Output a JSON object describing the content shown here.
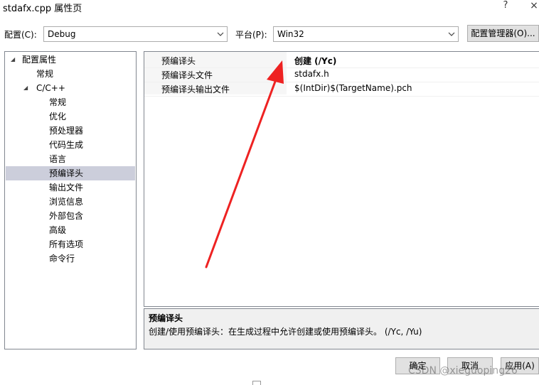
{
  "window": {
    "title": "stdafx.cpp 属性页",
    "help": "?",
    "close": "×"
  },
  "toolbar": {
    "config_label": "配置(C):",
    "config_value": "Debug",
    "platform_label": "平台(P):",
    "platform_value": "Win32",
    "config_manager_label": "配置管理器(O)..."
  },
  "tree": {
    "root": "配置属性",
    "general": "常规",
    "cpp": "C/C++",
    "cpp_children": [
      "常规",
      "优化",
      "预处理器",
      "代码生成",
      "语言",
      "预编译头",
      "输出文件",
      "浏览信息",
      "外部包含",
      "高级",
      "所有选项",
      "命令行"
    ],
    "selected": "预编译头"
  },
  "grid": {
    "rows": [
      {
        "name": "预编译头",
        "value": "创建 (/Yc)",
        "bold": true
      },
      {
        "name": "预编译头文件",
        "value": "stdafx.h",
        "bold": false
      },
      {
        "name": "预编译头输出文件",
        "value": "$(IntDir)$(TargetName).pch",
        "bold": false
      }
    ]
  },
  "description": {
    "title": "预编译头",
    "text": "创建/使用预编译头：在生成过程中允许创建或使用预编译头。     (/Yc, /Yu)"
  },
  "buttons": {
    "ok": "确定",
    "cancel": "取消",
    "apply": "应用(A)"
  },
  "watermark": "CSDN @xieguoping26",
  "annotation": {
    "arrow_color": "#ee2222"
  }
}
